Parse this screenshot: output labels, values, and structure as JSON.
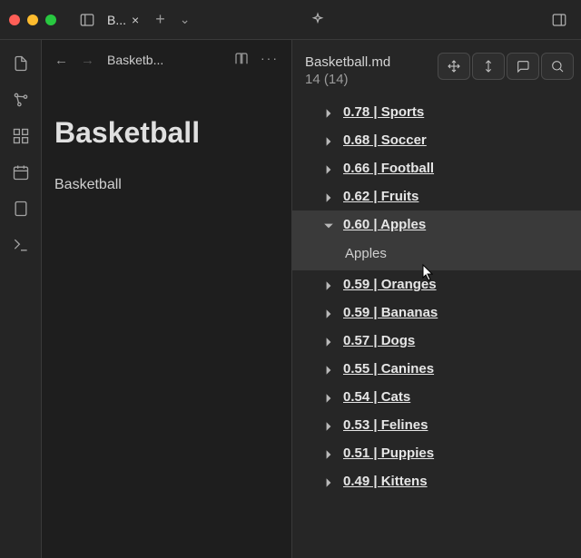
{
  "titlebar": {
    "tab_label": "B...",
    "close_glyph": "×",
    "plus_glyph": "+",
    "chev_glyph": "⌄"
  },
  "editor": {
    "breadcrumb": "Basketb...",
    "title": "Basketball",
    "content": "Basketball"
  },
  "panel": {
    "filename": "Basketball.md",
    "count_text": "14 (14)",
    "results": [
      {
        "score": "0.78",
        "name": "Sports",
        "expanded": false
      },
      {
        "score": "0.68",
        "name": "Soccer",
        "expanded": false
      },
      {
        "score": "0.66",
        "name": "Football",
        "expanded": false
      },
      {
        "score": "0.62",
        "name": "Fruits",
        "expanded": false
      },
      {
        "score": "0.60",
        "name": "Apples",
        "expanded": true,
        "child": "Apples"
      },
      {
        "score": "0.59",
        "name": "Oranges",
        "expanded": false
      },
      {
        "score": "0.59",
        "name": "Bananas",
        "expanded": false
      },
      {
        "score": "0.57",
        "name": "Dogs",
        "expanded": false
      },
      {
        "score": "0.55",
        "name": "Canines",
        "expanded": false
      },
      {
        "score": "0.54",
        "name": "Cats",
        "expanded": false
      },
      {
        "score": "0.53",
        "name": "Felines",
        "expanded": false
      },
      {
        "score": "0.51",
        "name": "Puppies",
        "expanded": false
      },
      {
        "score": "0.49",
        "name": "Kittens",
        "expanded": false
      }
    ]
  },
  "icons": {
    "sep": " | "
  }
}
